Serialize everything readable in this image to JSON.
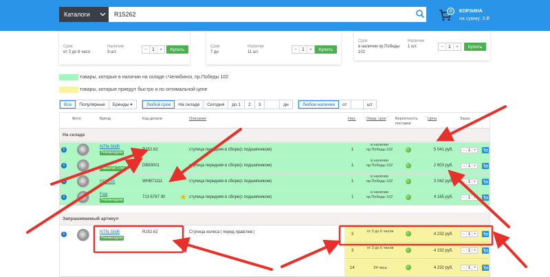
{
  "header": {
    "catalog_label": "Каталоги",
    "search_value": "R15262",
    "cart_count": "0",
    "cart_title": "КОРЗИНА",
    "cart_sum": "на сумму: 0 ₽"
  },
  "offers": [
    {
      "term_label": "Срок",
      "term_value": "от 3 до 6 часо",
      "avail_label": "Наличие",
      "avail_value": "3 шт.",
      "qty": "1",
      "buy_label": "Купить"
    },
    {
      "term_label": "Срок",
      "term_value": "7 дн",
      "avail_label": "Наличие",
      "avail_value": "11 шт.",
      "qty": "1",
      "buy_label": "Купить"
    },
    {
      "term_label": "Срок",
      "term_value": "в наличии пр.Победы 102",
      "avail_label": "Наличие",
      "avail_value": "1 шт.",
      "qty": "1",
      "buy_label": "Купить"
    }
  ],
  "legend": {
    "green_text": "товары, которые в наличии на складе г.Челябинск, пр.Победы 102",
    "yellow_text": "товары, которые приедут быстро и по оптимальной цене",
    "green_color": "#a6f5bf",
    "yellow_color": "#f7f3a0"
  },
  "filters": {
    "group1": [
      "Все",
      "Популярные",
      "Бренды ▾"
    ],
    "group2": [
      "Любой срок",
      "На складе",
      "Сегодня",
      "до 1",
      "2",
      "3",
      "",
      "дн"
    ],
    "group3": [
      "Любое наличие",
      "от",
      "",
      "шт"
    ]
  },
  "table": {
    "headers": {
      "photo": "Фото",
      "brand": "Бренд",
      "code": "Код детали",
      "desc": "Описание",
      "avail": "Нал.",
      "term": "Ожид. срок",
      "prob": "Вероятность поставки",
      "price": "Цена",
      "order": "Заказ"
    },
    "section_stock": "На складе",
    "section_req": "Запрашиваемый артикул",
    "stock_rows": [
      {
        "brand": "NTN-SNR",
        "badge": "Рекомендуем",
        "code": "R152.62",
        "desc": "ступица передняя в сборе(с подшипником)",
        "avail": "1",
        "term": "в наличии пр.Победы 102",
        "price": "5 041 руб.",
        "qty": "1"
      },
      {
        "brand": "",
        "badge": "Гарантия 1 год",
        "code": "DB83001",
        "desc": "ступица передняя в сборе(с подшипником)",
        "avail": "1",
        "term": "в наличии пр.Победы 102",
        "price": "2 603 руб.",
        "qty": "1"
      },
      {
        "brand": "FENOX",
        "badge": "",
        "code": "WHB71111",
        "desc": "ступица передняя в сборе(с подшипником)",
        "avail": "1",
        "term": "в наличии пр.Победы 102",
        "price": "3 042 руб.",
        "qty": "1"
      },
      {
        "brand": "Fag",
        "badge": "Рекомендуем",
        "code": "713 6787 90",
        "desc": "ступица передняя в сборе(с подшипником)",
        "avail": "1",
        "term": "в наличии пр.Победы 102",
        "price": "4 165 руб.",
        "qty": "1"
      }
    ],
    "req_item": {
      "brand": "NTN-SNR",
      "badge": "Рекомендуем",
      "code": "R152.62",
      "desc": "Ступица колеса | перед прав/лев |"
    },
    "req_rows": [
      {
        "avail": "3",
        "term": "от 3 до 6 часов",
        "price": "4 232 руб.",
        "qty": "1"
      },
      {
        "avail": "3",
        "term": "от 3 до 6 часов",
        "price": "4 232 руб.",
        "qty": "1"
      },
      {
        "avail": "14",
        "term": "24 часа",
        "price": "4 232 руб.",
        "qty": "1"
      }
    ]
  }
}
